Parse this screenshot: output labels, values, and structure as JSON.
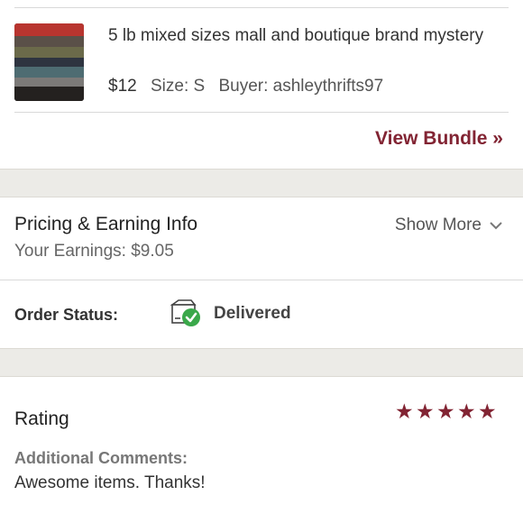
{
  "item": {
    "title": "5 lb mixed sizes mall and boutique brand mystery",
    "price": "$12",
    "size_label": "Size: S",
    "buyer_label": "Buyer: ashleythrifts97"
  },
  "bundle": {
    "link_label": "View Bundle »"
  },
  "pricing": {
    "title": "Pricing & Earning Info",
    "earnings": "Your Earnings: $9.05",
    "show_more_label": "Show More"
  },
  "order": {
    "label": "Order Status:",
    "status": "Delivered",
    "status_icon": "package-delivered-icon"
  },
  "rating": {
    "label": "Rating",
    "stars": 5,
    "comments_label": "Additional Comments:",
    "comments": "Awesome items. Thanks!"
  },
  "colors": {
    "accent": "#822433",
    "band": "#ecebe7",
    "success": "#3aa84a"
  }
}
